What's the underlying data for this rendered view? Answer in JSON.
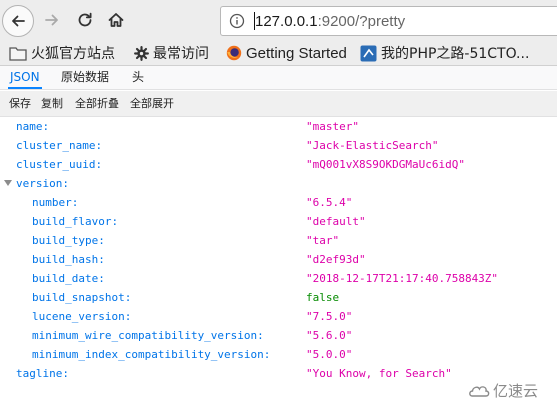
{
  "nav": {
    "url_prefix": "127.0.0.1",
    "url_suffix": ":9200/?pretty",
    "icons": [
      "back-arrow-icon",
      "forward-arrow-icon",
      "reload-icon",
      "home-icon",
      "info-icon"
    ]
  },
  "bookmarks": [
    {
      "label": "火狐官方站点",
      "icon": "folder-icon"
    },
    {
      "label": "最常访问",
      "icon": "gear-icon"
    },
    {
      "label": "Getting Started",
      "icon": "firefox-icon"
    },
    {
      "label": "我的PHP之路-51CTO...",
      "icon": "site-favicon-icon"
    }
  ],
  "tabs": [
    {
      "label": "JSON",
      "active": true
    },
    {
      "label": "原始数据",
      "active": false
    },
    {
      "label": "头",
      "active": false
    }
  ],
  "toolbar": {
    "save": "保存",
    "copy": "复制",
    "collapse_all": "全部折叠",
    "expand_all": "全部展开"
  },
  "json": {
    "name_key": "name:",
    "name_val": "\"master\"",
    "cluster_name_key": "cluster_name:",
    "cluster_name_val": "\"Jack-ElasticSearch\"",
    "cluster_uuid_key": "cluster_uuid:",
    "cluster_uuid_val": "\"mQ001vX8S9OKDGMaUc6idQ\"",
    "version_key": "version:",
    "number_key": "number:",
    "number_val": "\"6.5.4\"",
    "build_flavor_key": "build_flavor:",
    "build_flavor_val": "\"default\"",
    "build_type_key": "build_type:",
    "build_type_val": "\"tar\"",
    "build_hash_key": "build_hash:",
    "build_hash_val": "\"d2ef93d\"",
    "build_date_key": "build_date:",
    "build_date_val": "\"2018-12-17T21:17:40.758843Z\"",
    "build_snapshot_key": "build_snapshot:",
    "build_snapshot_val": "false",
    "lucene_version_key": "lucene_version:",
    "lucene_version_val": "\"7.5.0\"",
    "min_wire_key": "minimum_wire_compatibility_version:",
    "min_wire_val": "\"5.6.0\"",
    "min_index_key": "minimum_index_compatibility_version:",
    "min_index_val": "\"5.0.0\"",
    "tagline_key": "tagline:",
    "tagline_val": "\"You Know, for Search\""
  },
  "watermark": {
    "text": "亿速云"
  },
  "colors": {
    "key": "#0074e8",
    "string": "#dd00a9",
    "boolean": "#058b00",
    "active_tab": "#0a84ff"
  }
}
